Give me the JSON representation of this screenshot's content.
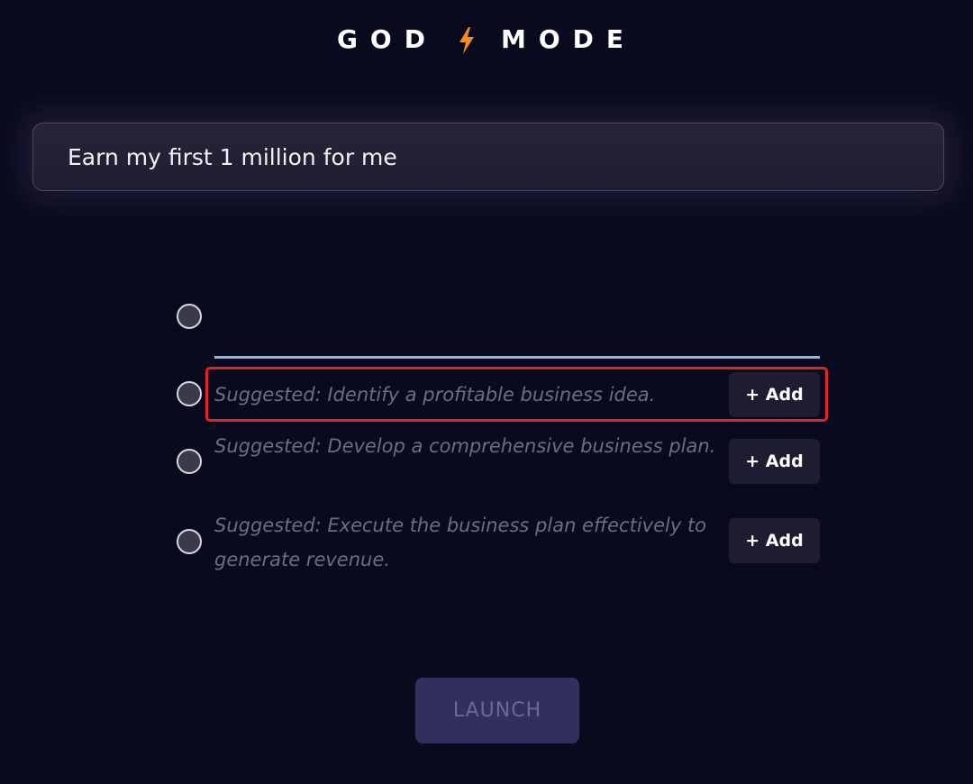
{
  "header": {
    "title_left": "GOD",
    "title_right": "MODE",
    "icon": "lightning-bolt-icon",
    "icon_color": "#f28c28"
  },
  "goal": {
    "value": "Earn my first 1 million for me"
  },
  "tasks": {
    "new_task_value": ""
  },
  "suggestions": [
    {
      "text": "Suggested: Identify a profitable business idea.",
      "add_label": "+ Add",
      "highlighted": true
    },
    {
      "text": "Suggested: Develop a comprehensive business plan.",
      "add_label": "+ Add",
      "highlighted": false
    },
    {
      "text": "Suggested: Execute the business plan effectively to generate revenue.",
      "add_label": "+ Add",
      "highlighted": false
    }
  ],
  "launch": {
    "label": "LAUNCH",
    "disabled": true
  },
  "colors": {
    "background": "#0a0a1e",
    "input_underline": "#8fb5ee",
    "highlight": "#e02424",
    "launch_bg": "#332f5c"
  }
}
